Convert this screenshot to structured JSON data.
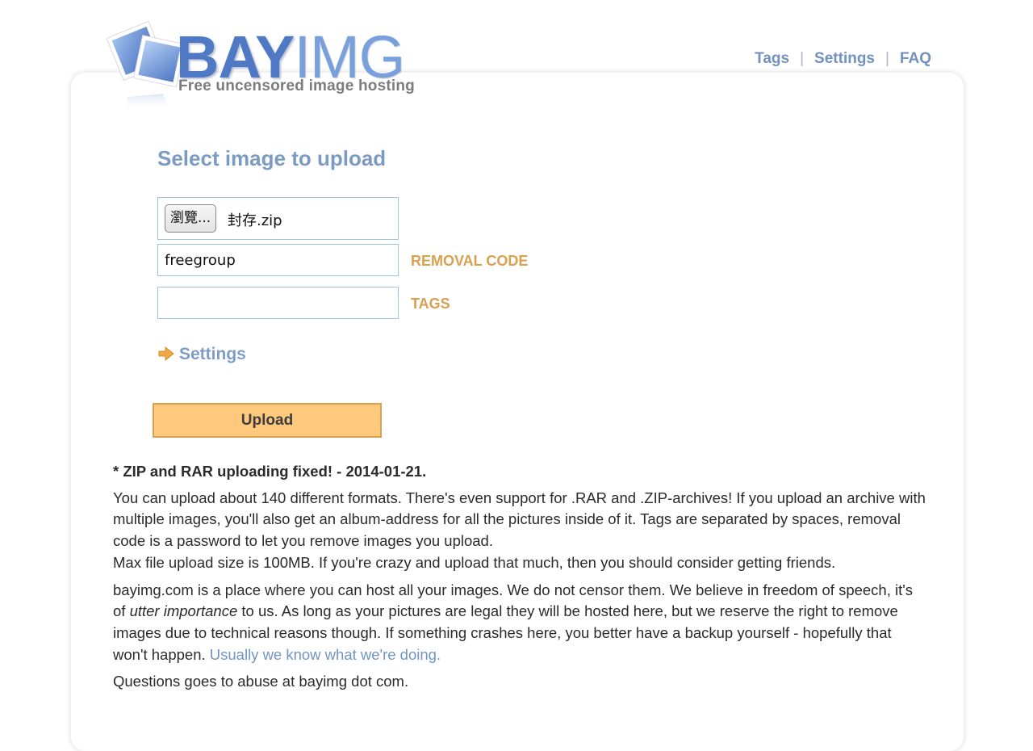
{
  "logo": {
    "bay": "BAY",
    "img": "IMG",
    "tagline": "Free uncensored image hosting"
  },
  "nav": {
    "tags": "Tags",
    "settings": "Settings",
    "faq": "FAQ",
    "separator": "|"
  },
  "upload_form": {
    "heading": "Select image to upload",
    "browse_label": "瀏覽...",
    "file_name": "封存.zip",
    "removal_code_value": "freegroup",
    "removal_code_label": "REMOVAL CODE",
    "tags_value": "",
    "tags_label": "TAGS",
    "settings_label": "Settings",
    "upload_button": "Upload"
  },
  "info": {
    "notice": "* ZIP and RAR uploading fixed! - 2014-01-21.",
    "paragraph1": "You can upload about 140 different formats. There's even support for .RAR and .ZIP-archives! If you upload an archive with multiple images, you'll also get an album-address for all the pictures inside of it. Tags are separated by spaces, removal code is a password to let you remove images you upload.",
    "paragraph1b": "Max file upload size is 100MB. If you're crazy and upload that much, then you should consider getting friends.",
    "paragraph2_start": "bayimg.com is a place where you can host all your images. We do not censor them. We believe in freedom of speech, it's of ",
    "paragraph2_em": "utter importance",
    "paragraph2_end": " to us. As long as your pictures are legal they will be hosted here, but we reserve the right to remove images due to technical reasons though. If something crashes here, you better have a backup yourself - hopefully that won't happen. ",
    "paragraph2_link": "Usually we know what we're doing.",
    "paragraph3": "Questions goes to abuse at bayimg dot com."
  },
  "colors": {
    "brand_blue": "#4f79c4",
    "nav_link": "#7292bd",
    "label_orange": "#d9a050",
    "upload_button_fill": "#fec87d"
  },
  "icons": {
    "settings_toggle": "orange-right-arrow-icon",
    "logo_mark": "stacked-photos-icon"
  }
}
